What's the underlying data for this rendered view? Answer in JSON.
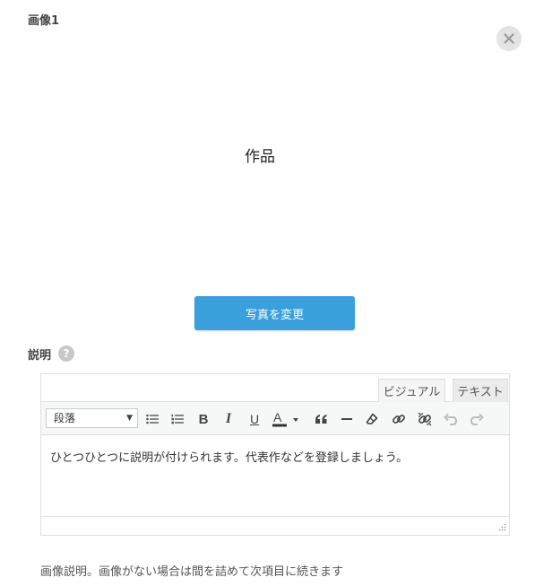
{
  "image_section": {
    "label": "画像1",
    "preview_text": "作品",
    "change_button": "写真を変更"
  },
  "description": {
    "label": "説明",
    "help_symbol": "?"
  },
  "editor": {
    "tabs": {
      "visual": "ビジュアル",
      "text": "テキスト"
    },
    "format_select": "段落",
    "toolbar_icons": [
      "bulleted-list-icon",
      "numbered-list-icon",
      "bold-icon",
      "italic-icon",
      "underline-icon",
      "text-color-icon",
      "blockquote-icon",
      "horizontal-line-icon",
      "clear-formatting-icon",
      "insert-link-icon",
      "remove-link-icon",
      "undo-icon",
      "redo-icon"
    ],
    "content": "ひとつひとつに説明が付けられます。代表作などを登録しましょう。"
  },
  "caption": "画像説明。画像がない場合は間を詰めて次項目に続きます",
  "colors": {
    "accent": "#3aa0dc",
    "text_color_bar": "#333333"
  }
}
